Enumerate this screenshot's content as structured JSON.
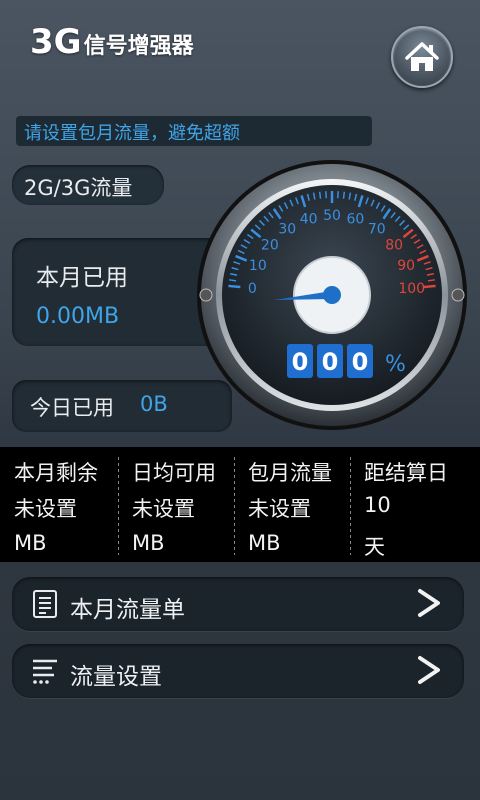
{
  "app": {
    "title_main": "3G",
    "title_sub": "信号增强器"
  },
  "banner": {
    "text": "请设置包月流量，避免超额"
  },
  "network_mode": {
    "label": "2G/3G流量"
  },
  "month_used": {
    "label": "本月已用",
    "value": "0.00MB"
  },
  "today_used": {
    "label": "今日已用",
    "value": "0B"
  },
  "gauge": {
    "ticks": [
      "0",
      "10",
      "20",
      "30",
      "40",
      "50",
      "60",
      "70",
      "80",
      "90",
      "100"
    ],
    "digits": [
      "0",
      "0",
      "0"
    ],
    "percent_sign": "%",
    "needle_value": 0,
    "colors": {
      "low": "#3a8fe0",
      "high": "#e0453a"
    }
  },
  "stats": [
    {
      "header": "本月剩余",
      "value": "未设置",
      "unit": "MB"
    },
    {
      "header": "日均可用",
      "value": "未设置",
      "unit": "MB"
    },
    {
      "header": "包月流量",
      "value": "未设置",
      "unit": "MB"
    },
    {
      "header": "距结算日",
      "value": "10",
      "unit": "天"
    }
  ],
  "menu": [
    {
      "label": "本月流量单",
      "icon": "document-list-icon"
    },
    {
      "label": "流量设置",
      "icon": "settings-list-icon"
    }
  ]
}
